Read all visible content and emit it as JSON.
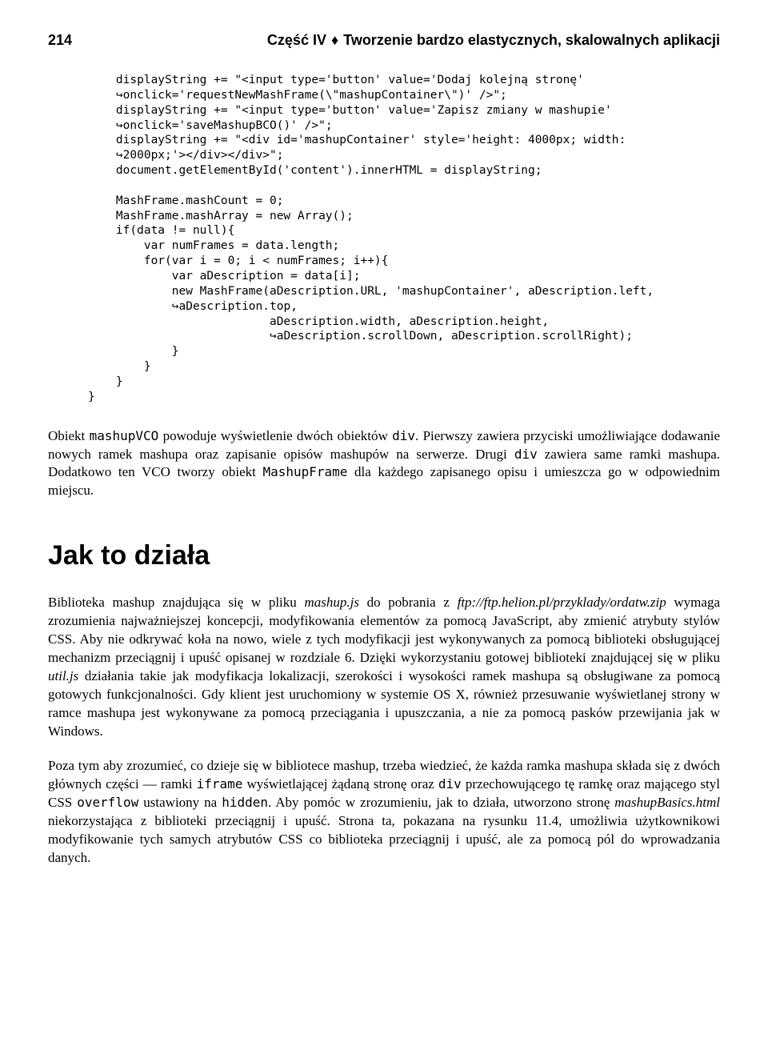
{
  "header": {
    "page_number": "214",
    "running_head_prefix": "Część IV",
    "running_head_suffix": "Tworzenie bardzo elastycznych, skalowalnych aplikacji"
  },
  "code": {
    "l1": "    displayString += \"<input type='button' value='Dodaj kolejną stronę'",
    "l2": "onclick='requestNewMashFrame(\\\"mashupContainer\\\")' />\";",
    "l3": "    displayString += \"<input type='button' value='Zapisz zmiany w mashupie'",
    "l4": "onclick='saveMashupBCO()' />\";",
    "l5": "    displayString += \"<div id='mashupContainer' style='height: 4000px; width:",
    "l6": "2000px;'></div></div>\";",
    "l7": "    document.getElementById('content').innerHTML = displayString;",
    "l8": "",
    "l9": "    MashFrame.mashCount = 0;",
    "l10": "    MashFrame.mashArray = new Array();",
    "l11": "    if(data != null){",
    "l12": "        var numFrames = data.length;",
    "l13": "        for(var i = 0; i < numFrames; i++){",
    "l14": "            var aDescription = data[i];",
    "l15": "            new MashFrame(aDescription.URL, 'mashupContainer', aDescription.left,",
    "l16": "aDescription.top,",
    "l17": "                          aDescription.width, aDescription.height,",
    "l18": "aDescription.scrollDown, aDescription.scrollRight);",
    "l19": "            }",
    "l20": "        }",
    "l21": "    }",
    "l22": "}"
  },
  "para1_pre": "Obiekt ",
  "para1_m1": "mashupVCO",
  "para1_mid1": " powoduje wyświetlenie dwóch obiektów ",
  "para1_m2": "div",
  "para1_mid2": ". Pierwszy zawiera przyciski umożliwiające dodawanie nowych ramek mashupa oraz zapisanie opisów mashupów na serwerze. Drugi ",
  "para1_m3": "div",
  "para1_mid3": " zawiera same ramki mashupa. Dodatkowo ten VCO tworzy obiekt ",
  "para1_m4": "MashupFrame",
  "para1_end": " dla każdego zapisanego opisu i umieszcza go w odpowiednim miejscu.",
  "section_heading": "Jak to działa",
  "para2_a": "Biblioteka mashup znajdująca się w pliku ",
  "para2_i1": "mashup.js",
  "para2_b": " do pobrania z ",
  "para2_i2": "ftp://ftp.helion.pl/przyklady/ordatw.zip",
  "para2_c": " wymaga zrozumienia najważniejszej koncepcji, modyfikowania elementów za pomocą JavaScript, aby zmienić atrybuty stylów CSS. Aby nie odkrywać koła na nowo, wiele z tych modyfikacji jest wykonywanych za pomocą biblioteki obsługującej mechanizm przeciągnij i upuść opisanej w rozdziale 6. Dzięki wykorzystaniu gotowej biblioteki znajdującej się w pliku ",
  "para2_i3": "util.js",
  "para2_d": " działania takie jak modyfikacja lokalizacji, szerokości i wysokości ramek mashupa są obsługiwane za pomocą gotowych funkcjonalności. Gdy klient jest uruchomiony w systemie OS X, również przesuwanie wyświetlanej strony w ramce mashupa jest wykonywane za pomocą przeciągania i upuszczania, a nie za pomocą pasków przewijania jak w Windows.",
  "para3_a": "Poza tym aby zrozumieć, co dzieje się w bibliotece mashup, trzeba wiedzieć, że każda ramka mashupa składa się z dwóch głównych części — ramki ",
  "para3_m1": "iframe",
  "para3_b": " wyświetlającej żądaną stronę oraz ",
  "para3_m2": "div",
  "para3_c": " przechowującego tę ramkę oraz mającego styl CSS ",
  "para3_m3": "overflow",
  "para3_d": " ustawiony na ",
  "para3_m4": "hidden",
  "para3_e": ". Aby pomóc w zrozumieniu, jak to działa, utworzono stronę ",
  "para3_i1": "mashupBasics.html",
  "para3_f": " niekorzystająca z biblioteki przeciągnij i upuść. Strona ta, pokazana na rysunku 11.4, umożliwia użytkownikowi modyfikowanie tych samych atrybutów CSS co biblioteka przeciągnij i upuść, ale za pomocą pól do wprowadzania danych."
}
